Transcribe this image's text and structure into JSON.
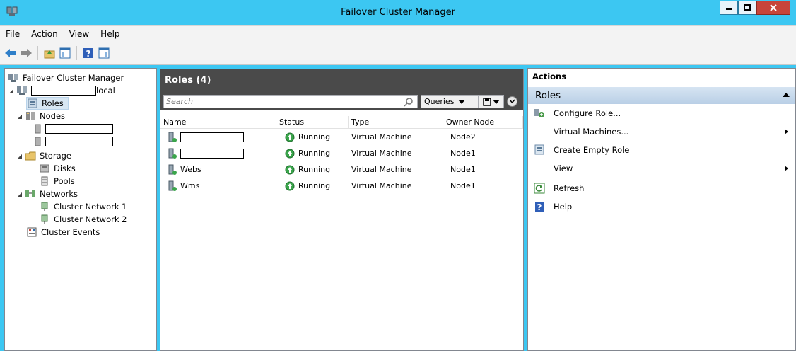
{
  "window": {
    "title": "Failover Cluster Manager"
  },
  "menu": [
    "File",
    "Action",
    "View",
    "Help"
  ],
  "toolbar": {
    "icons": [
      "back-arrow-icon",
      "forward-arrow-icon",
      "up-folder-icon",
      "show-hide-tree-icon",
      "help-icon",
      "show-hide-action-pane-icon"
    ]
  },
  "tree": {
    "root": "Failover Cluster Manager",
    "cluster_suffix": "local",
    "roles": "Roles",
    "nodes": "Nodes",
    "storage": "Storage",
    "disks": "Disks",
    "pools": "Pools",
    "networks": "Networks",
    "network1": "Cluster Network 1",
    "network2": "Cluster Network 2",
    "events": "Cluster Events"
  },
  "center": {
    "title": "Roles (4)",
    "search_placeholder": "Search",
    "queries_label": "Queries",
    "columns": {
      "name": "Name",
      "status": "Status",
      "type": "Type",
      "owner": "Owner Node"
    },
    "rows": [
      {
        "name": "",
        "status": "Running",
        "type": "Virtual Machine",
        "owner": "Node2"
      },
      {
        "name": "",
        "status": "Running",
        "type": "Virtual Machine",
        "owner": "Node1"
      },
      {
        "name": "Webs",
        "status": "Running",
        "type": "Virtual Machine",
        "owner": "Node1"
      },
      {
        "name": "Wms",
        "status": "Running",
        "type": "Virtual Machine",
        "owner": "Node1"
      }
    ]
  },
  "actions": {
    "title": "Actions",
    "section": "Roles",
    "items": {
      "configure": "Configure Role...",
      "vms": "Virtual Machines...",
      "create": "Create Empty Role",
      "view": "View",
      "refresh": "Refresh",
      "help": "Help"
    }
  },
  "colors": {
    "titlebar": "#3cc7f2",
    "close": "#c7453a",
    "section": "#c7d9ec",
    "running": "#3aa54b"
  }
}
